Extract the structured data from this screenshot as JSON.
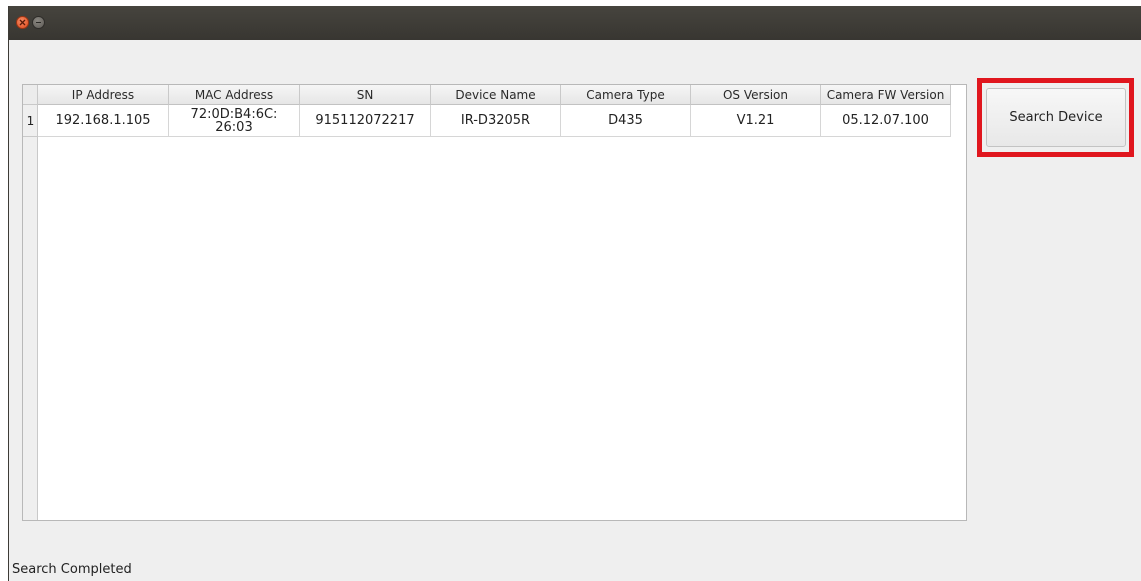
{
  "table": {
    "columns": [
      "IP Address",
      "MAC Address",
      "SN",
      "Device Name",
      "Camera Type",
      "OS Version",
      "Camera FW Version"
    ],
    "rows": [
      {
        "index": "1",
        "ip": "192.168.1.105",
        "mac": "72:0D:B4:6C:\n26:03",
        "sn": "915112072217",
        "device_name": "IR-D3205R",
        "camera_type": "D435",
        "os_version": "V1.21",
        "fw_version": "05.12.07.100"
      }
    ]
  },
  "buttons": {
    "search_device": "Search Device"
  },
  "status": {
    "text": "Search Completed"
  },
  "colors": {
    "highlight": "#e0161e",
    "titlebar": "#3c3a35",
    "window_bg": "#efefef"
  }
}
